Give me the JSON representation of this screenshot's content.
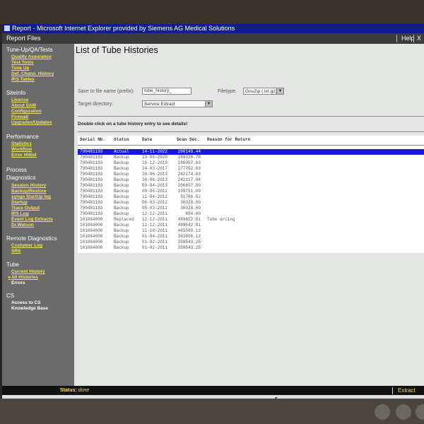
{
  "window": {
    "title": "Report - Microsoft Internet Explorer provided by Siemens AG Medical Solutions"
  },
  "menubar": {
    "report_files": "Report Files",
    "help": "Help",
    "close": "X"
  },
  "sidebar": {
    "sections": [
      {
        "title": "Tune-Up/QA/Tests",
        "items": [
          "Quality Assurance",
          "Test Tools",
          "Tune Up",
          "Def. Chann. History",
          "IRS Tables"
        ]
      },
      {
        "title": "SiteInfo",
        "items": [
          "License",
          "About SAM",
          "Configuration",
          "Firewall",
          "Upgrades/Updates"
        ]
      },
      {
        "title": "Performance",
        "items": [
          "Statistics",
          "Workflow",
          "Error Hitlist"
        ]
      },
      {
        "title": "Process Diagnostics",
        "items": [
          "Session History",
          "Backup/Restore",
          "syngo StartUp log",
          "Startup",
          "Trace Output",
          "IRS Log",
          "Event Log Extracts",
          "Dr.Watson"
        ]
      },
      {
        "title": "Remote Diagnostics",
        "items": [
          "Customer Log",
          "SRS"
        ]
      },
      {
        "title": "Tube",
        "items": [
          "Current History",
          "All Histories",
          "Errors"
        ]
      },
      {
        "title": "CS",
        "items": [
          "Access to CS",
          "Knowledge Base"
        ]
      }
    ]
  },
  "main": {
    "title": "List of Tube Histories",
    "save_label": "Save to file name (prefix):",
    "save_value": "tube_history_",
    "filetype_label": "Filetype:",
    "filetype_value": "GnuZip (.txt.gz)",
    "target_label": "Target directory:",
    "target_value": "Service Extract",
    "instruction": "Double click on a tube history entry to see details!"
  },
  "table": {
    "headers": [
      "Serial Nb.",
      "Status",
      "Date",
      "Scan Sec.",
      "Reason for Return"
    ],
    "rows": [
      [
        "790481193",
        "Actual",
        "14-11-2022",
        "290149.44",
        ""
      ],
      [
        "790481193",
        "Backup",
        "13-08-2020",
        "289320.78",
        ""
      ],
      [
        "790481193",
        "Backup",
        "16-12-2019",
        "286057.63",
        ""
      ],
      [
        "790481193",
        "Backup",
        "24-03-2017",
        "277792.03",
        ""
      ],
      [
        "790481193",
        "Backup",
        "28-06-2013",
        "242174.63",
        ""
      ],
      [
        "790481193",
        "Backup",
        "28-06-2013",
        "242117.94",
        ""
      ],
      [
        "790481193",
        "Backup",
        "03-04-2013",
        "206657.50",
        ""
      ],
      [
        "790481193",
        "Backup",
        "09-08-2012",
        "109751.09",
        ""
      ],
      [
        "790481193",
        "Backup",
        "11-04-2012",
        "51786.52",
        ""
      ],
      [
        "790481193",
        "Backup",
        "06-03-2012",
        "36028.50",
        ""
      ],
      [
        "790481193",
        "Backup",
        "05-03-2012",
        "36028.50",
        ""
      ],
      [
        "790481193",
        "Backup",
        "12-12-2011",
        "694.00",
        ""
      ],
      [
        "101084000",
        "Replaced",
        "12-12-2011",
        "489622.81",
        "Tube arcing"
      ],
      [
        "101084000",
        "Backup",
        "12-12-2011",
        "489542.81",
        ""
      ],
      [
        "101084000",
        "Backup",
        "11-10-2011",
        "465599.13",
        ""
      ],
      [
        "101084000",
        "Backup",
        "01-04-2011",
        "383806.13",
        ""
      ],
      [
        "101084000",
        "Backup",
        "01-02-2011",
        "358543.25",
        ""
      ],
      [
        "101084000",
        "Backup",
        "01-02-2011",
        "358543.25",
        ""
      ]
    ]
  },
  "statusbar": {
    "label": "Status:",
    "value": "done",
    "extract": "Extract"
  }
}
